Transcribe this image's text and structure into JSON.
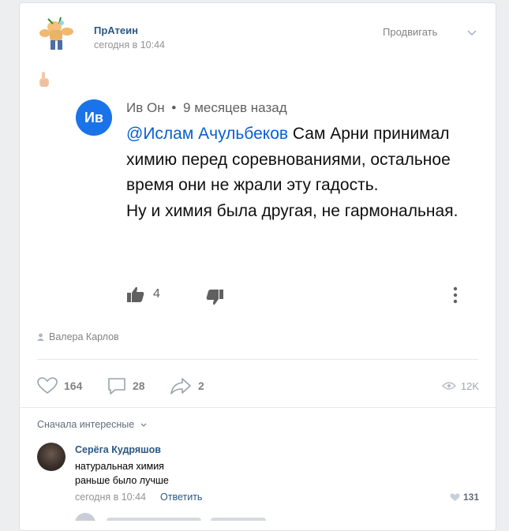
{
  "post": {
    "community_name": "ПрАтеин",
    "time": "сегодня в 10:44",
    "promote_label": "Продвигать",
    "author": "Валера Карлов"
  },
  "embedded_comment": {
    "avatar_initials": "Ив",
    "author": "Ив Он",
    "separator": "•",
    "age": "9 месяцев назад",
    "mention": "@Ислам Ачульбеков",
    "text_line1": " Сам Арни принимал химию перед соревнованиями, остальное время они не жрали эту гадость.",
    "text_line2": "Ну и химия была другая, не гармональная.",
    "likes": "4"
  },
  "stats": {
    "likes": "164",
    "comments": "28",
    "shares": "2",
    "views": "12K"
  },
  "comments_section": {
    "sort_label": "Сначала интересные",
    "items": [
      {
        "author": "Серёга Кудряшов",
        "line1": "натуральная химия",
        "line2": "раньше было лучше",
        "time": "сегодня в 10:44",
        "reply_label": "Ответить",
        "likes": "131"
      }
    ]
  },
  "colors": {
    "link": "#2a5885",
    "youtube_link": "#065fd4",
    "avatar_blue": "#1a73e8"
  }
}
